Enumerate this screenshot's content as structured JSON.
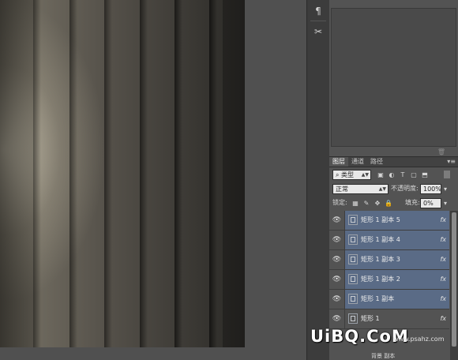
{
  "colors": {
    "selected_layer": "#5a6b86",
    "panel_bg": "#535353",
    "field_bg": "#e8e8e8"
  },
  "dock": {
    "items": [
      {
        "icon": "paragraph-icon",
        "glyph": "¶"
      },
      {
        "icon": "brush-settings-icon",
        "glyph": "✂"
      }
    ]
  },
  "layers_panel": {
    "tabs": [
      "图层",
      "通道",
      "路径"
    ],
    "active_tab": "图层",
    "menu_glyph": "▾≡",
    "filter_kind": "类型",
    "filter_icons": [
      "image-filter-icon",
      "adjustment-filter-icon",
      "type-filter-icon",
      "shape-filter-icon",
      "smart-object-filter-icon"
    ],
    "blend_mode": "正常",
    "opacity_label": "不透明度:",
    "opacity_value": "100%",
    "lock_label": "锁定:",
    "fill_label": "填充:",
    "fill_value": "0%",
    "layers": [
      {
        "name": "矩形 1 副本 5",
        "fx": "fx",
        "selected": true
      },
      {
        "name": "矩形 1 副本 4",
        "fx": "fx",
        "selected": true
      },
      {
        "name": "矩形 1 副本 3",
        "fx": "fx",
        "selected": true
      },
      {
        "name": "矩形 1 副本 2",
        "fx": "fx",
        "selected": true
      },
      {
        "name": "矩形 1 副本",
        "fx": "fx",
        "selected": true
      },
      {
        "name": "矩形 1",
        "fx": "fx",
        "selected": false
      }
    ],
    "bottom_partial_label": "背景 副本"
  },
  "watermark": {
    "text": "UiBQ.CoM",
    "url": "www.psahz.com"
  }
}
